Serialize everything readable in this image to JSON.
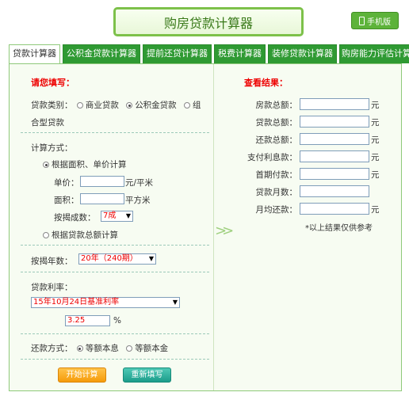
{
  "header": {
    "title": "购房贷款计算器",
    "mobile_label": "手机版"
  },
  "tabs": [
    "贷款计算器",
    "公积金贷款计算器",
    "提前还贷计算器",
    "税费计算器",
    "装修贷款计算器",
    "购房能力评估计算"
  ],
  "form": {
    "heading": "请您填写：",
    "loan_type_label": "贷款类别：",
    "loan_types": [
      "商业贷款",
      "公积金贷款",
      "组合型贷款"
    ],
    "loan_type_part1": "组",
    "loan_type_part2": "合型贷款",
    "calc_method_label": "计算方式：",
    "method_area": "根据面积、单价计算",
    "unit_price_label": "单价：",
    "unit_price_unit": "元/平米",
    "area_label": "面积：",
    "area_unit": "平方米",
    "mortgage_ratio_label": "按揭成数：",
    "mortgage_ratio_value": "7成",
    "method_total": "根据贷款总额计算",
    "years_label": "按揭年数：",
    "years_value": "20年（240期）",
    "rate_label": "贷款利率：",
    "rate_option": "15年10月24日基准利率",
    "rate_value": "3.25",
    "rate_unit": "%",
    "repay_label": "还款方式：",
    "repay_equal_interest": "等额本息",
    "repay_equal_principal": "等额本金",
    "start_btn": "开始计算",
    "reset_btn": "重新填写"
  },
  "results": {
    "heading": "查看结果：",
    "rows": [
      {
        "label": "房款总额：",
        "unit": "元"
      },
      {
        "label": "贷款总额：",
        "unit": "元"
      },
      {
        "label": "还款总额：",
        "unit": "元"
      },
      {
        "label": "支付利息款：",
        "unit": "元"
      },
      {
        "label": "首期付款：",
        "unit": "元"
      },
      {
        "label": "贷款月数：",
        "unit": ""
      },
      {
        "label": "月均还款：",
        "unit": "元"
      }
    ],
    "note": "*以上结果仅供参考"
  }
}
